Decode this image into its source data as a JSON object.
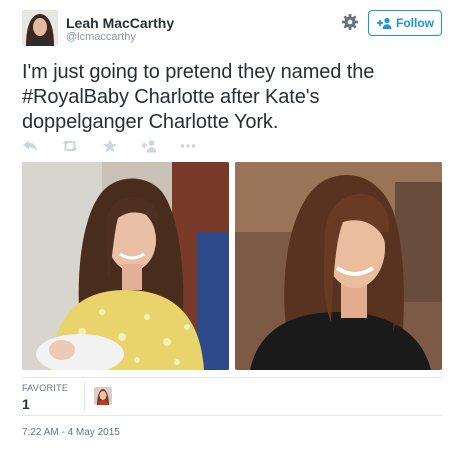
{
  "tweet": {
    "author": {
      "display_name": "Leah MacCarthy",
      "handle": "@lcmaccarthy"
    },
    "follow_button_label": "Follow",
    "text_lines": [
      "I'm just going to pretend they named the",
      "#RoyalBaby Charlotte after Kate's",
      "doppelganger Charlotte York."
    ],
    "actions": [
      "reply-icon",
      "retweet-icon",
      "favorite-icon",
      "follow-icon",
      "more-icon"
    ],
    "stats": {
      "favorites_label": "FAVORITE",
      "favorites_count": "1"
    },
    "timestamp": "7:22 AM - 4 May 2015"
  },
  "colors": {
    "accent": "#1b95e0",
    "text": "#292f33",
    "muted": "#8899a6",
    "action_icon": "#ccd6dd",
    "divider": "#e1e8ed"
  }
}
